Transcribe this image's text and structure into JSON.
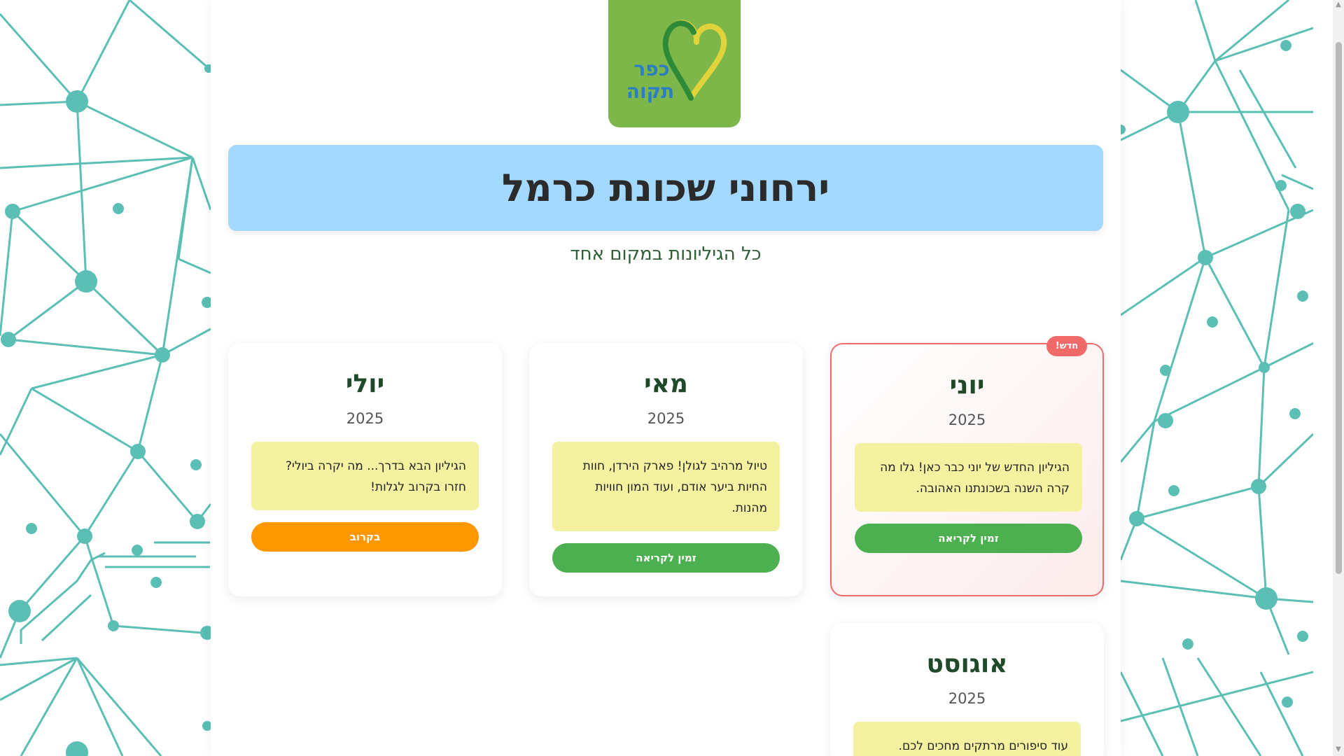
{
  "logo": {
    "text_line1": "כפר",
    "text_line2": "תקוה",
    "icon": "heart-logo-icon",
    "background": "#7db749"
  },
  "header": {
    "title": "ירחוני שכונת כרמל",
    "subtitle": "כל הגיליונות במקום אחד",
    "banner_color": "#a3d8ff"
  },
  "cards": [
    {
      "month": "יוני",
      "year": "2025",
      "description": "הגיליון החדש של יוני כבר כאן! גלו מה קרה השנה בשכונתנו האהובה.",
      "button_label": "זמין לקריאה",
      "badge": "חדש!",
      "button_color": "#4caf50"
    },
    {
      "month": "מאי",
      "year": "2025",
      "description": "טיול מרהיב לגולן! פארק הירדן, חוות החיות ביער אודם, ועוד המון חוויות מהנות.",
      "button_label": "זמין לקריאה",
      "button_color": "#4caf50"
    },
    {
      "month": "יולי",
      "year": "2025",
      "description": "הגיליון הבא בדרך... מה יקרה ביולי? חזרו בקרוב לגלות!",
      "button_label": "בקרוב",
      "button_color": "#ff9800"
    },
    {
      "month": "אוגוסט",
      "year": "2025",
      "description": "עוד סיפורים מרתקים מחכים לכם."
    }
  ],
  "colors": {
    "accent_network": "#5bbfb5",
    "card_note_bg": "#f4f1a0",
    "new_border": "#f06a6a"
  }
}
